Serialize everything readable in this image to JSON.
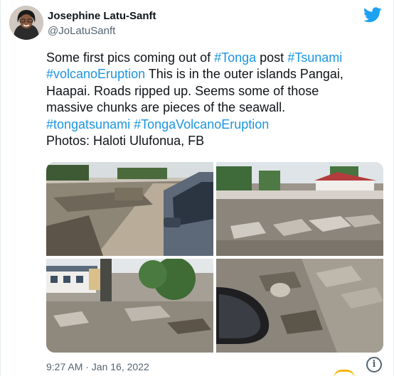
{
  "author": {
    "name": "Josephine Latu-Sanft",
    "handle": "@JoLatuSanft"
  },
  "tweet": {
    "line1_pre": "Some first pics coming out of ",
    "tag_tonga": "#Tonga",
    "line1_mid": " post ",
    "tag_tsunami": "#Tsunami",
    "tag_volcano": "#volcanoEruption",
    "line2_post": " This is in the outer islands Pangai,",
    "line3": "Haapai. Roads ripped up. Seems some of those",
    "line4": "massive chunks are pieces of the seawall.",
    "tag_tongatsunami": "#tongatsunami",
    "tag_tongavolcano": "#TongaVolcanoEruption",
    "credit": "Photos: Haloti Ulufonua, FB"
  },
  "timestamp": "9:27 AM · Jan 16, 2022",
  "icons": {
    "brand": "twitter-bird-icon",
    "info": "info-icon"
  },
  "info_glyph": "i",
  "colors": {
    "link": "#1b95e0",
    "brand": "#1da1f2",
    "muted": "#536471"
  }
}
